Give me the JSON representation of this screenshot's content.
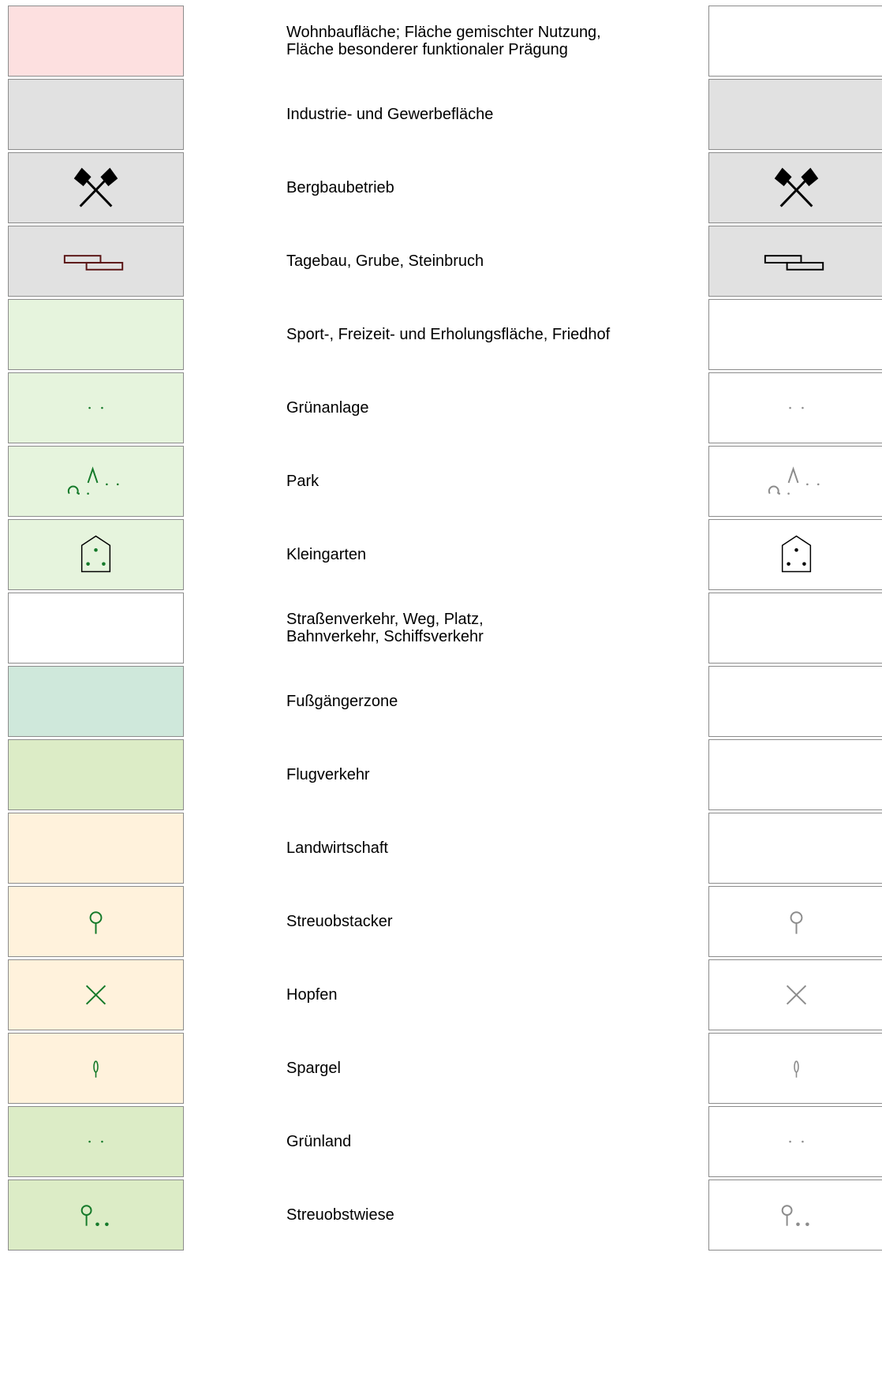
{
  "colors": {
    "border": "#8c8c8c",
    "green_symbol": "#157a2a",
    "grey_symbol": "#8c8c8c",
    "black_symbol": "#000000",
    "dark_red_symbol": "#5a1414"
  },
  "legend": [
    {
      "label": "Wohnbaufläche; Fläche gemischter Nutzung,\nFläche besonderer funktionaler Prägung",
      "color_fill": "#fde0e0",
      "mono_fill": "#ffffff",
      "symbol": "none"
    },
    {
      "label": "Industrie- und Gewerbefläche",
      "color_fill": "#e1e1e1",
      "mono_fill": "#e1e1e1",
      "symbol": "none"
    },
    {
      "label": "Bergbaubetrieb",
      "color_fill": "#e1e1e1",
      "mono_fill": "#e1e1e1",
      "symbol": "mining-icon"
    },
    {
      "label": "Tagebau, Grube, Steinbruch",
      "color_fill": "#e1e1e1",
      "mono_fill": "#e1e1e1",
      "symbol": "quarry-icon"
    },
    {
      "label": "Sport-, Freizeit- und Erholungsfläche, Friedhof",
      "color_fill": "#e6f4dd",
      "mono_fill": "#ffffff",
      "symbol": "none"
    },
    {
      "label": "Grünanlage",
      "color_fill": "#e6f4dd",
      "mono_fill": "#ffffff",
      "symbol": "dots-icon"
    },
    {
      "label": "Park",
      "color_fill": "#e6f4dd",
      "mono_fill": "#ffffff",
      "symbol": "park-icon"
    },
    {
      "label": "Kleingarten",
      "color_fill": "#e6f4dd",
      "mono_fill": "#ffffff",
      "symbol": "allotment-icon"
    },
    {
      "label": "Straßenverkehr, Weg, Platz,\nBahnverkehr, Schiffsverkehr",
      "color_fill": "#ffffff",
      "mono_fill": "#ffffff",
      "symbol": "none"
    },
    {
      "label": "Fußgängerzone",
      "color_fill": "#cfe8db",
      "mono_fill": "#ffffff",
      "symbol": "none"
    },
    {
      "label": "Flugverkehr",
      "color_fill": "#dcecc6",
      "mono_fill": "#ffffff",
      "symbol": "none"
    },
    {
      "label": "Landwirtschaft",
      "color_fill": "#fff2dc",
      "mono_fill": "#ffffff",
      "symbol": "none"
    },
    {
      "label": "Streuobstacker",
      "color_fill": "#fff2dc",
      "mono_fill": "#ffffff",
      "symbol": "orchard-tree-icon"
    },
    {
      "label": "Hopfen",
      "color_fill": "#fff2dc",
      "mono_fill": "#ffffff",
      "symbol": "hops-cross-icon"
    },
    {
      "label": "Spargel",
      "color_fill": "#fff2dc",
      "mono_fill": "#ffffff",
      "symbol": "asparagus-icon"
    },
    {
      "label": "Grünland",
      "color_fill": "#dcecc6",
      "mono_fill": "#ffffff",
      "symbol": "dots-icon"
    },
    {
      "label": "Streuobstwiese",
      "color_fill": "#dcecc6",
      "mono_fill": "#ffffff",
      "symbol": "orchard-meadow-icon"
    }
  ]
}
